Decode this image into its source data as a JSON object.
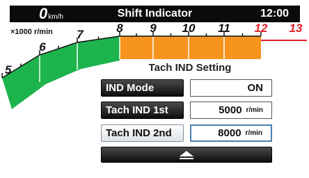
{
  "header": {
    "speed_value": "0",
    "speed_unit": "km/h",
    "title": "Shift Indicator",
    "time": "12:00"
  },
  "tach": {
    "unit_label": "×1000 r/min",
    "ticks": [
      {
        "label": "5",
        "redline": false
      },
      {
        "label": "6",
        "redline": false
      },
      {
        "label": "7",
        "redline": false
      },
      {
        "label": "8",
        "redline": false
      },
      {
        "label": "9",
        "redline": false
      },
      {
        "label": "10",
        "redline": false
      },
      {
        "label": "11",
        "redline": false
      },
      {
        "label": "12",
        "redline": true
      },
      {
        "label": "13",
        "redline": true
      }
    ],
    "colors": {
      "green_zone": "#1db34d",
      "orange_zone": "#f7941d",
      "redline": "#e0202a",
      "scale": "#111111"
    },
    "green_zone_rpm": [
      5,
      8
    ],
    "orange_zone_rpm": [
      8,
      12
    ]
  },
  "panel": {
    "title": "Tach IND Setting",
    "rows": [
      {
        "label": "IND Mode",
        "value": "ON",
        "unit": ""
      },
      {
        "label": "Tach IND 1st",
        "value": "5000",
        "unit": "r/min"
      },
      {
        "label": "Tach IND 2nd",
        "value": "8000",
        "unit": "r/min"
      }
    ],
    "up_button_icon": "eject-up-icon"
  }
}
